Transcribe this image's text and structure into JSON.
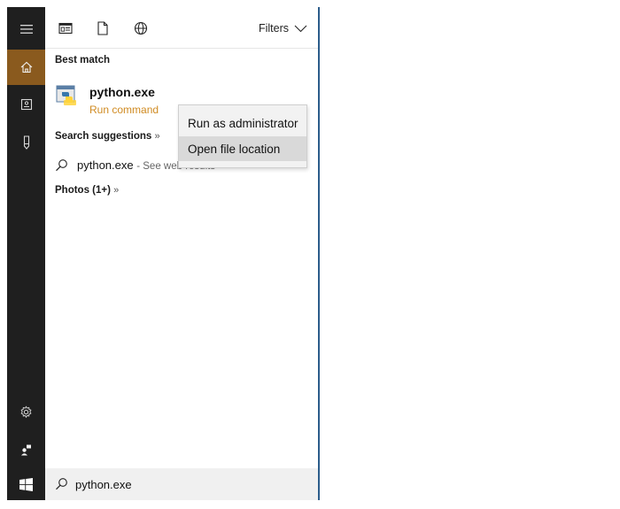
{
  "toolbar": {
    "filters_label": "Filters",
    "icons": [
      "apps-icon",
      "documents-icon",
      "web-icon",
      "chevron-down-icon"
    ]
  },
  "rail": {
    "items": [
      "menu-icon",
      "home-icon",
      "notebook-icon",
      "device-icon",
      "settings-icon",
      "feedback-icon"
    ]
  },
  "best_match": {
    "heading": "Best match",
    "title": "python.exe",
    "subtitle": "Run command"
  },
  "suggestions": {
    "heading": "Search suggestions",
    "heading_more": "»",
    "item_text": "python.exe",
    "item_hint": "- See web results"
  },
  "photos": {
    "heading": "Photos (1+)",
    "heading_more": "»"
  },
  "context_menu": {
    "items": [
      "Run as administrator",
      "Open file location"
    ],
    "highlighted": "Open file location"
  },
  "search": {
    "value": "python.exe"
  },
  "colors": {
    "rail_bg": "#1f1f1f",
    "active_accent": "#8a5a1e",
    "subtitle": "#d08b22",
    "divider_blue": "#2b5c8a"
  }
}
